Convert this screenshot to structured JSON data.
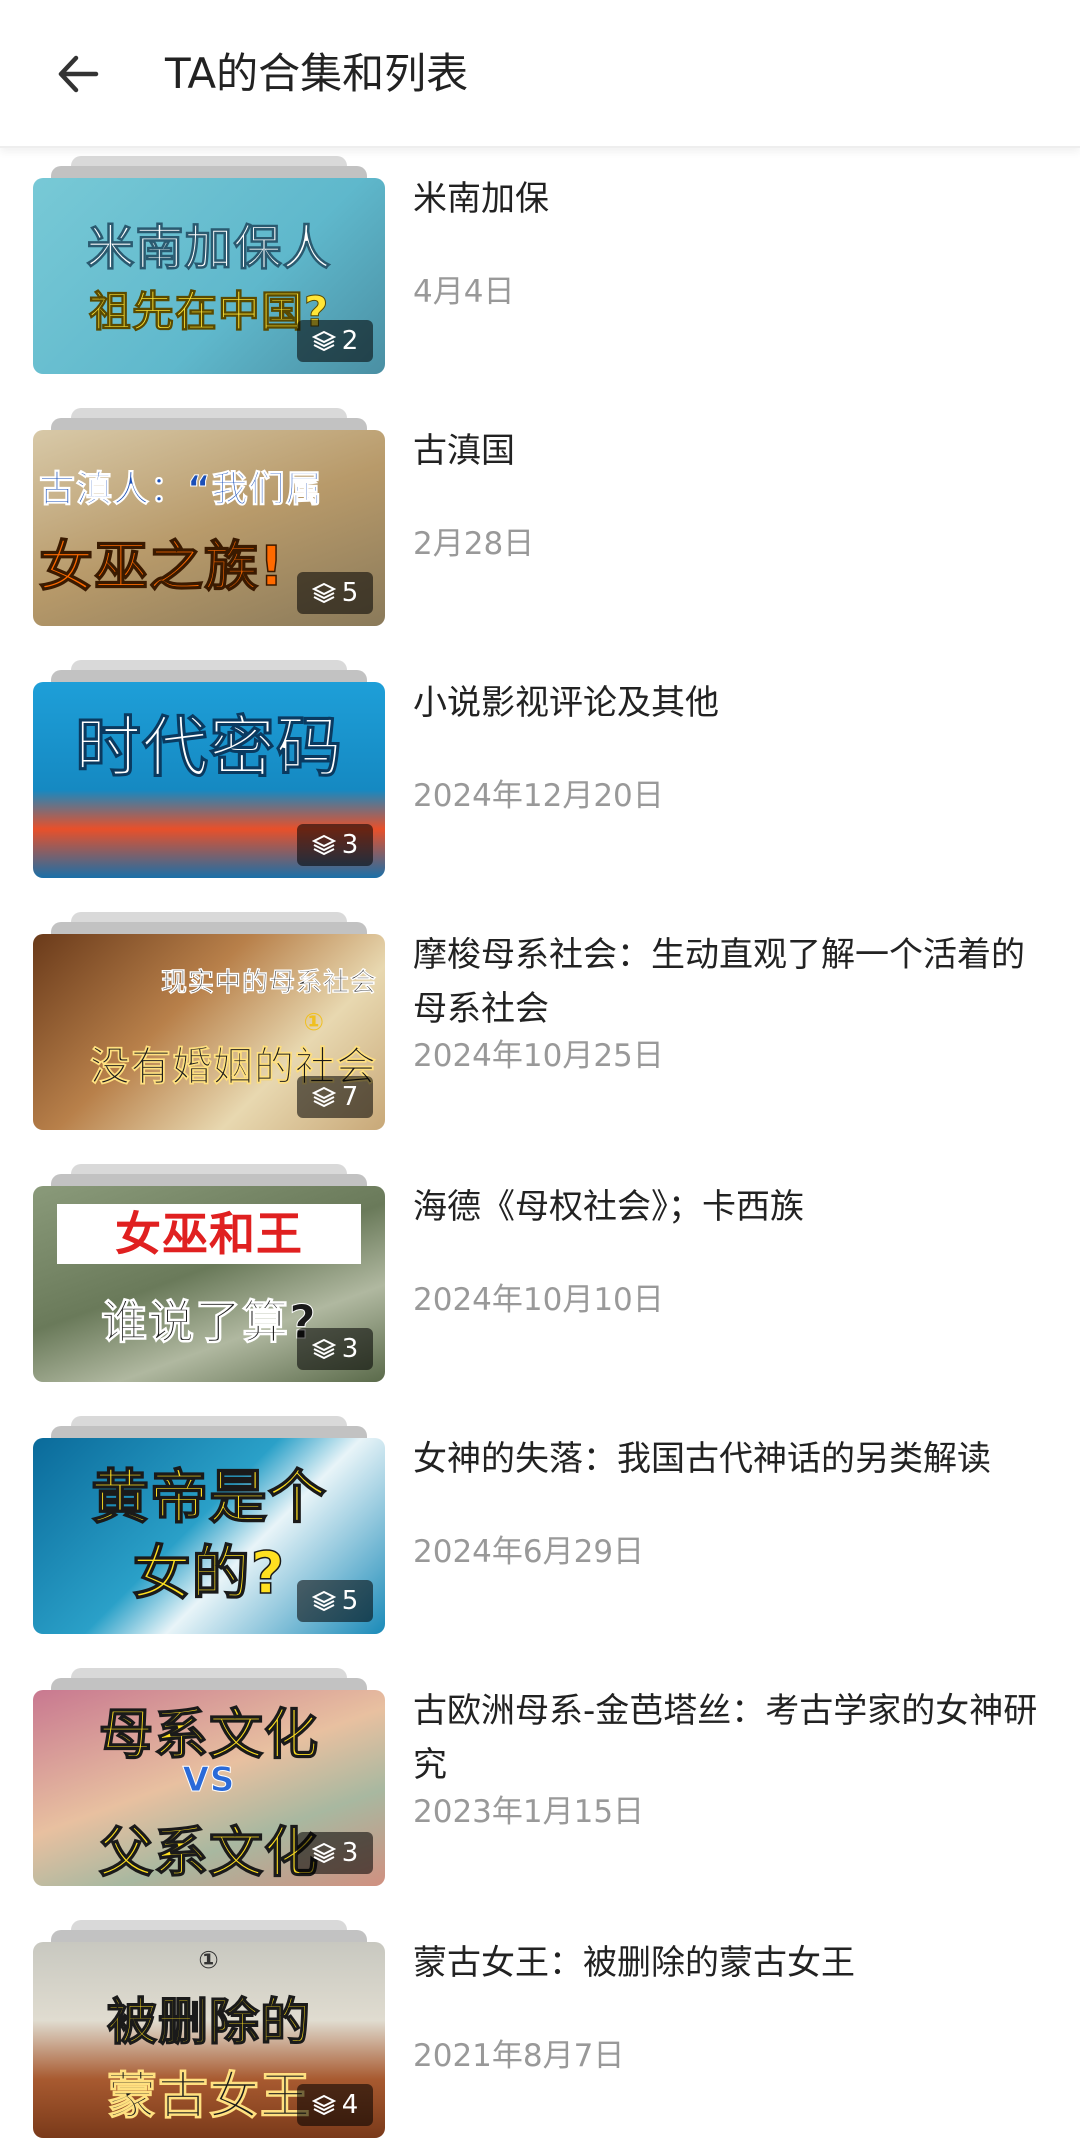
{
  "header": {
    "back_icon": "arrow-left-icon",
    "title": "TA的合集和列表"
  },
  "collections": [
    {
      "title": "米南加保",
      "date": "4月4日",
      "count": "2",
      "thumb_lines": [
        "米南加保人",
        "祖先在中国?"
      ]
    },
    {
      "title": "古滇国",
      "date": "2月28日",
      "count": "5",
      "thumb_lines": [
        "古滇人：“我们属",
        "女巫之族!"
      ]
    },
    {
      "title": "小说影视评论及其他",
      "date": "2024年12月20日",
      "count": "3",
      "thumb_lines": [
        "时代密码"
      ]
    },
    {
      "title": "摩梭母系社会：生动直观了解一个活着的母系社会",
      "date": "2024年10月25日",
      "count": "7",
      "thumb_lines": [
        "现实中的母系社会",
        "①",
        "没有婚姻的社会"
      ]
    },
    {
      "title": "海德《母权社会》；卡西族",
      "date": "2024年10月10日",
      "count": "3",
      "thumb_lines": [
        "女巫和王",
        "谁说了算?"
      ]
    },
    {
      "title": "女神的失落：我国古代神话的另类解读",
      "date": "2024年6月29日",
      "count": "5",
      "thumb_lines": [
        "黄帝是个",
        "女的?"
      ]
    },
    {
      "title": "古欧洲母系-金芭塔丝：考古学家的女神研究",
      "date": "2023年1月15日",
      "count": "3",
      "thumb_lines": [
        "母系文化",
        "VS",
        "父系文化"
      ]
    },
    {
      "title": "蒙古女王：被删除的蒙古女王",
      "date": "2021年8月7日",
      "count": "4",
      "thumb_lines": [
        "①",
        "被删除的",
        "蒙古女王"
      ]
    }
  ],
  "colors": {
    "title_text": "#222222",
    "date_text": "#999999",
    "badge_bg": "#000000",
    "divider": "#eeeeee"
  },
  "icons": {
    "count_icon": "layers-icon"
  }
}
